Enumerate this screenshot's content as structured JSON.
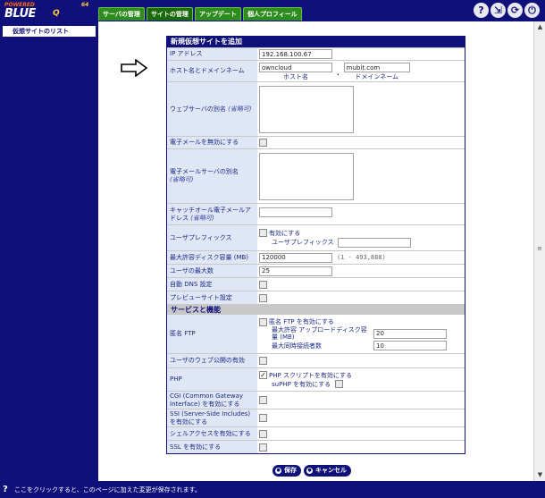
{
  "logo": {
    "brand": "POWERED",
    "name": "BLUE",
    "mark": "Q",
    "version": "64"
  },
  "tabs": [
    {
      "label": "サーバの管理",
      "active": false
    },
    {
      "label": "サイトの管理",
      "active": true
    },
    {
      "label": "アップデート",
      "active": false
    },
    {
      "label": "個人プロフィール",
      "active": false
    }
  ],
  "top_icons": [
    "help-icon",
    "logout-icon",
    "refresh-icon",
    "power-icon"
  ],
  "sidebar": {
    "items": [
      {
        "label": "仮想サイトのリスト"
      }
    ]
  },
  "form": {
    "title": "新規仮想サイトを追加",
    "ip": {
      "label": "IP アドレス",
      "value": "192.168.100.67"
    },
    "host": {
      "label": "ホスト名とドメインネーム",
      "host_value": "owncloud",
      "host_caption": "ホスト名",
      "separator": ".",
      "domain_value": "mubit.com",
      "domain_caption": "ドメインネーム"
    },
    "web_alias": {
      "label": "ウェブサーバの別名",
      "optional": "(省略可)"
    },
    "disable_email": {
      "label": "電子メールを無効にする"
    },
    "mail_alias": {
      "label": "電子メールサーバの別名",
      "optional": "(省略可)"
    },
    "catchall": {
      "label": "キャッチオール電子メールアドレス",
      "optional": "(省略可)"
    },
    "prefix": {
      "label": "ユーザプレフィックス",
      "enable_label": "有効にする",
      "prefix_label": "ユーザプレフィックス"
    },
    "quota": {
      "label": "最大許容ディスク容量 (MB)",
      "value": "120000",
      "hint": "(1 - 493,888)"
    },
    "max_users": {
      "label": "ユーザの最大数",
      "value": "25"
    },
    "auto_dns": {
      "label": "自動 DNS 設定"
    },
    "preview": {
      "label": "プレビューサイト設定"
    },
    "services_title": "サービスと機能",
    "anon_ftp": {
      "label": "匿名 FTP",
      "enable_label": "匿名 FTP を有効にする",
      "upload_label": "最大許容 アップロードディスク容量 (MB)",
      "upload_value": "20",
      "conn_label": "最大同時接続者数",
      "conn_value": "10"
    },
    "user_web": {
      "label": "ユーザのウェブ公開の有効"
    },
    "php": {
      "label": "PHP",
      "enable_label": "PHP スクリプトを有効にする",
      "suphp_label": "suPHP を有効にする",
      "enabled": true
    },
    "cgi": {
      "label": "CGI (Common Gateway Interface) を有効にする"
    },
    "ssi": {
      "label": "SSI (Server-Side Includes) を有効にする"
    },
    "shell": {
      "label": "シェルアクセスを有効にする"
    },
    "ssl": {
      "label": "SSL を有効にする"
    }
  },
  "buttons": {
    "save": "保存",
    "cancel": "キャンセル"
  },
  "status": {
    "text": "ここをクリックすると、このページに加えた変更が保存されます。"
  }
}
